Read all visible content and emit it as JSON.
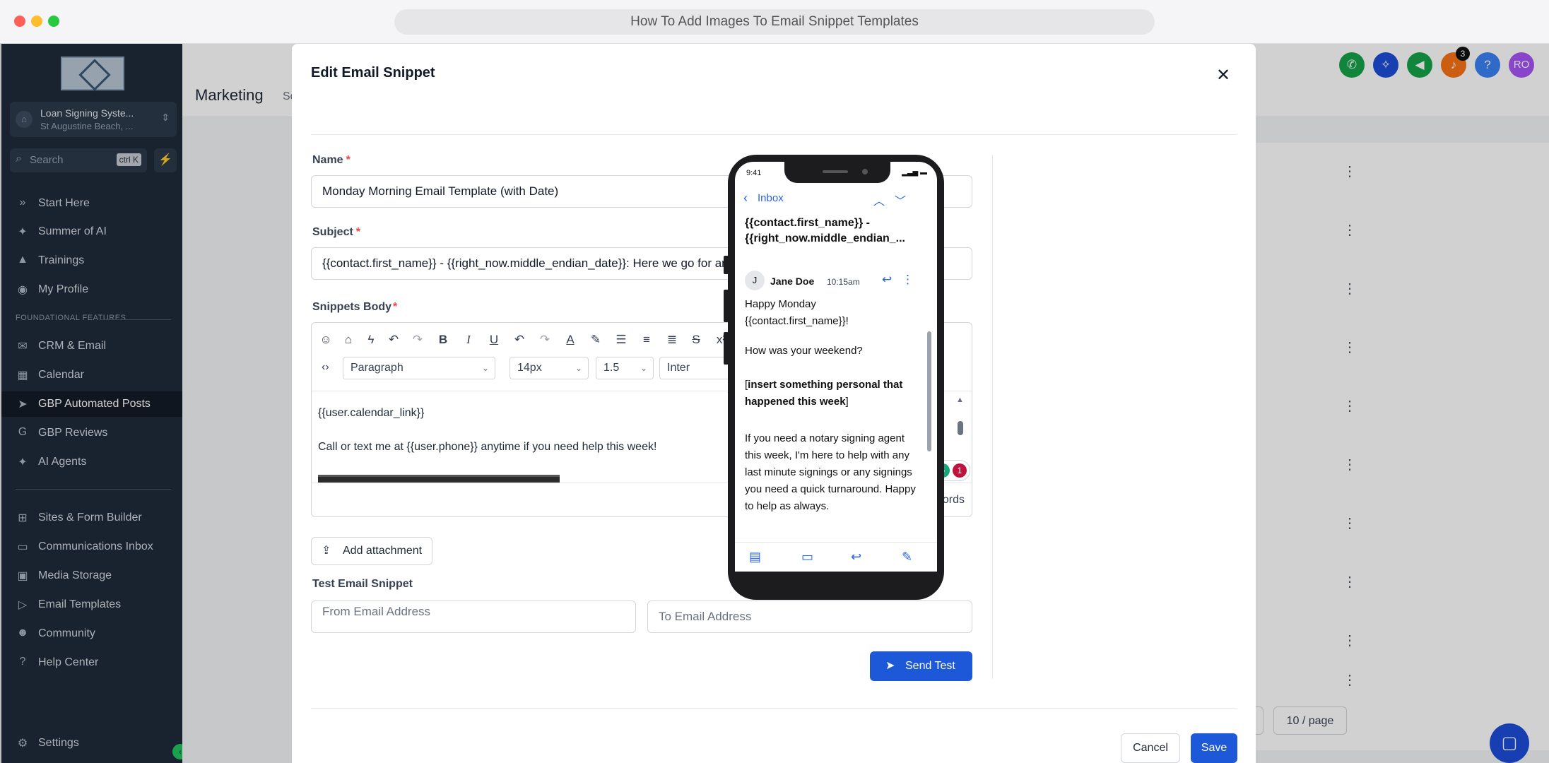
{
  "browser": {
    "title": "How To Add Images To Email Snippet Templates"
  },
  "sidebar": {
    "account_name": "Loan Signing Syste...",
    "account_location": "St Augustine Beach, ...",
    "search_placeholder": "Search",
    "search_shortcut": "ctrl K",
    "section_label": "FOUNDATIONAL FEATURES",
    "top_items": [
      {
        "label": "Start Here",
        "icon": "chevrons-right-icon"
      },
      {
        "label": "Summer of AI",
        "icon": "sparkle-icon"
      },
      {
        "label": "Trainings",
        "icon": "graduation-cap-icon"
      },
      {
        "label": "My Profile",
        "icon": "user-circle-icon"
      }
    ],
    "feature_items": [
      {
        "label": "CRM & Email",
        "icon": "mail-icon"
      },
      {
        "label": "Calendar",
        "icon": "calendar-icon"
      },
      {
        "label": "GBP Automated Posts",
        "icon": "send-icon"
      },
      {
        "label": "GBP Reviews",
        "icon": "google-icon"
      },
      {
        "label": "AI Agents",
        "icon": "sparkle-icon"
      }
    ],
    "bottom_items": [
      {
        "label": "Sites & Form Builder",
        "icon": "sitemap-icon"
      },
      {
        "label": "Communications Inbox",
        "icon": "inbox-icon"
      },
      {
        "label": "Media Storage",
        "icon": "image-icon"
      },
      {
        "label": "Email Templates",
        "icon": "play-circle-icon"
      },
      {
        "label": "Community",
        "icon": "users-icon"
      },
      {
        "label": "Help Center",
        "icon": "question-circle-icon"
      }
    ],
    "settings_label": "Settings"
  },
  "background": {
    "title": "Marketing",
    "subtitle": "Sc",
    "pager_label": "10 / page",
    "notification_count": "3",
    "avatar_initials": "RO"
  },
  "modal": {
    "title": "Edit Email Snippet",
    "name_label": "Name",
    "name_value": "Monday Morning Email Template (with Date)",
    "subject_label": "Subject",
    "subject_value": "{{contact.first_name}} - {{right_now.middle_endian_date}}: Here we go for another great week!",
    "body_label": "Snippets Body",
    "toolbar": {
      "paragraph": "Paragraph",
      "font_size": "14px",
      "line_height": "1.5",
      "font_family": "Inter"
    },
    "body_lines": [
      "{{user.calendar_link}}",
      "Call or text me at {{user.phone}} anytime if you need help this week!"
    ],
    "grammar_count": "1",
    "counts": "465 characters | 68 words",
    "add_attachment": "Add attachment",
    "test_label": "Test Email Snippet",
    "from_placeholder": "From Email Address",
    "to_placeholder": "To Email Address",
    "send_test": "Send Test",
    "cancel": "Cancel",
    "save": "Save"
  },
  "preview": {
    "status_time": "9:41",
    "inbox_label": "Inbox",
    "subject": "{{contact.first_name}} - {{right_now.middle_endian_...",
    "avatar_initial": "J",
    "sender": "Jane Doe",
    "time": "10:15am",
    "greeting": "Happy Monday {{contact.first_name}}!",
    "question": "How was your weekend?",
    "bracket_open": "[",
    "bold_insert": "insert something personal that happened this week",
    "bracket_close": "]",
    "paragraph": "If you need a notary signing agent this week, I'm here to help with any last minute signings or any signings you need a quick turnaround. Happy to help as always."
  },
  "colors": {
    "sidebar_bg": "#1f2a3a",
    "primary": "#1d58d8",
    "required": "#ef4444"
  }
}
